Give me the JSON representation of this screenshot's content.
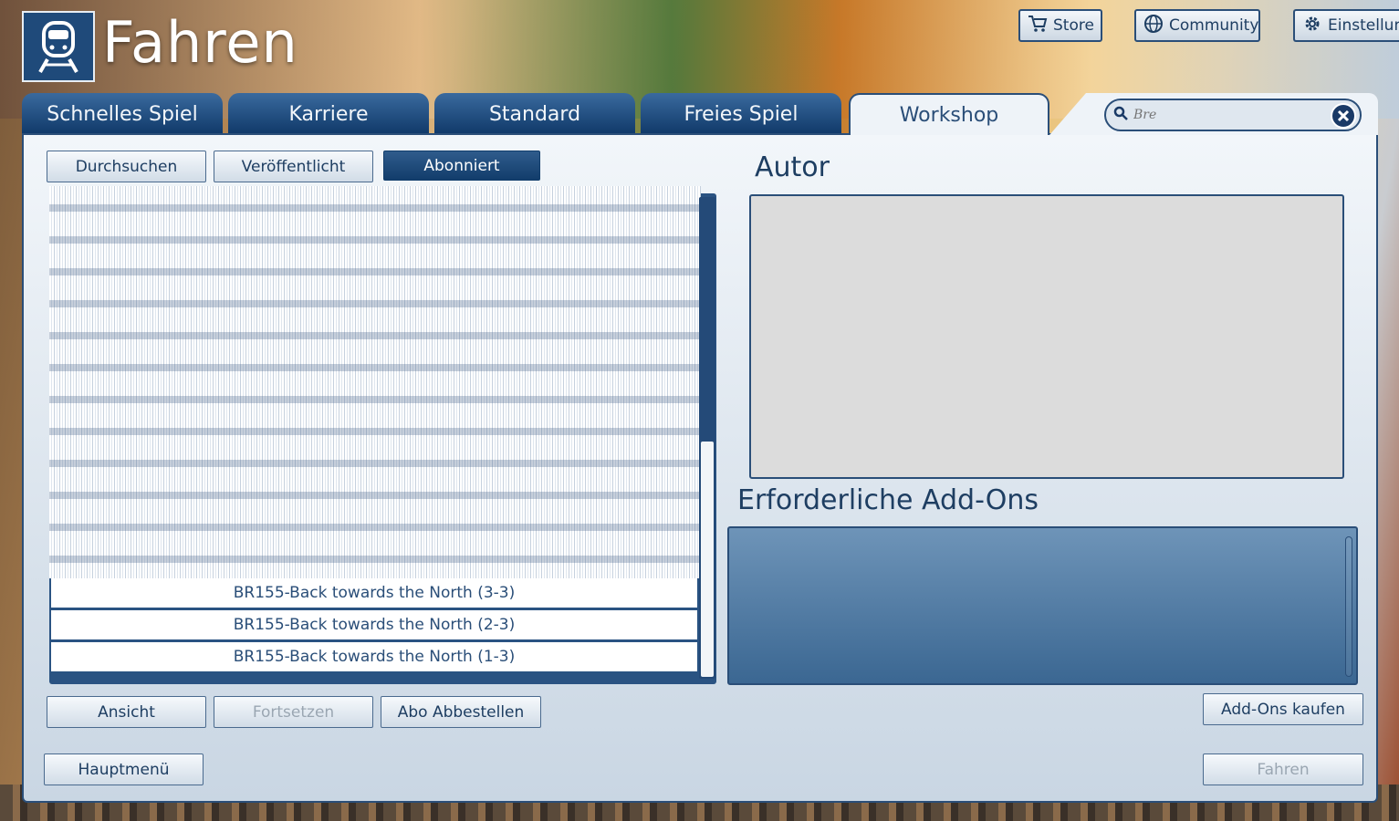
{
  "app": {
    "title": "Fahren"
  },
  "top_bar": {
    "store": "Store",
    "community": "Community",
    "settings": "Einstellun"
  },
  "tabs": [
    "Schnelles Spiel",
    "Karriere",
    "Standard",
    "Freies Spiel",
    "Workshop"
  ],
  "active_tab": "Workshop",
  "search": {
    "value": "",
    "placeholder": "Bre"
  },
  "filters": {
    "browse": "Durchsuchen",
    "published": "Veröffentlicht",
    "subscribed": "Abonniert"
  },
  "list": {
    "items": [
      "BR155-Back towards the North (3-3)",
      "BR155-Back towards the North (2-3)",
      "BR155-Back towards the North (1-3)"
    ]
  },
  "author": {
    "title": "Autor"
  },
  "addons": {
    "title": "Erforderliche Add-Ons",
    "buy": "Add-Ons kaufen"
  },
  "actions": {
    "view": "Ansicht",
    "continue": "Fortsetzen",
    "unsubscribe": "Abo Abbestellen",
    "main_menu": "Hauptmenü",
    "drive": "Fahren"
  },
  "colors": {
    "accent": "#1f4a7a",
    "panel": "#eef3f8",
    "addons_bg": "#5a82a8"
  }
}
